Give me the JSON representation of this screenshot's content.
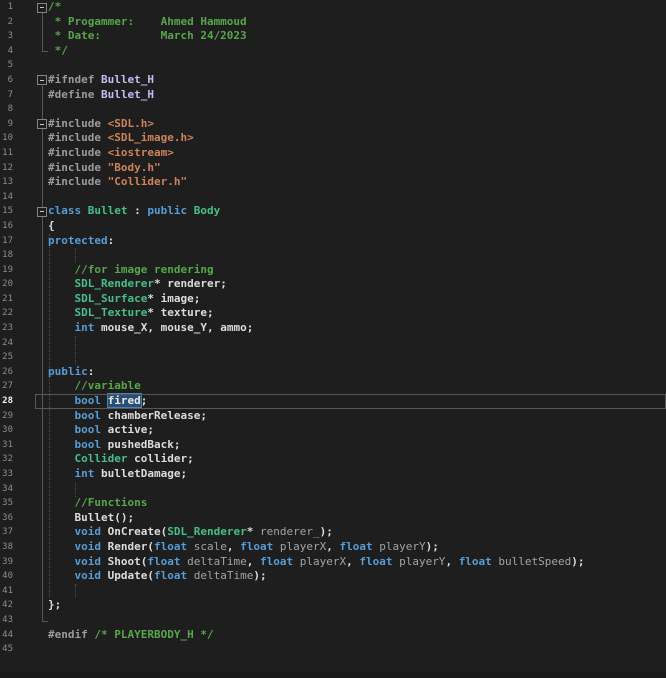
{
  "editor": {
    "kind": "code-editor-dark-theme",
    "current_line": 28,
    "selected_word": "fired",
    "total_lines": 45,
    "colors": {
      "background": "#1e1e1e",
      "plain_text": "#dcdcdc",
      "keyword": "#569cd6",
      "type": "#45c08a",
      "comment": "#57a64a",
      "string": "#ce8259",
      "preprocessor": "#9b9b9b",
      "macro": "#c3bcf5",
      "parameter": "#a3a3a3",
      "line_number": "#8c8c8c",
      "selection_background": "#264f78",
      "current_line_border": "#585858"
    },
    "lines": [
      {
        "n": 1,
        "fold": true,
        "tokens": [
          [
            "c",
            "/*"
          ]
        ]
      },
      {
        "n": 2,
        "tokens": [
          [
            "c",
            " * Progammer:    Ahmed Hammoud"
          ]
        ]
      },
      {
        "n": 3,
        "tokens": [
          [
            "c",
            " * Date:         March 24/2023"
          ]
        ]
      },
      {
        "n": 4,
        "tokens": [
          [
            "c",
            " */"
          ]
        ]
      },
      {
        "n": 5,
        "tokens": []
      },
      {
        "n": 6,
        "fold": true,
        "tokens": [
          [
            "d",
            "#ifndef "
          ],
          [
            "m",
            "Bullet_H"
          ]
        ]
      },
      {
        "n": 7,
        "tokens": [
          [
            "d",
            "#define "
          ],
          [
            "m",
            "Bullet_H"
          ]
        ]
      },
      {
        "n": 8,
        "tokens": []
      },
      {
        "n": 9,
        "fold": true,
        "tokens": [
          [
            "d",
            "#include "
          ],
          [
            "s",
            "<SDL.h>"
          ]
        ]
      },
      {
        "n": 10,
        "tokens": [
          [
            "d",
            "#include "
          ],
          [
            "s",
            "<SDL_image.h>"
          ]
        ]
      },
      {
        "n": 11,
        "tokens": [
          [
            "d",
            "#include "
          ],
          [
            "s",
            "<iostream>"
          ]
        ]
      },
      {
        "n": 12,
        "tokens": [
          [
            "d",
            "#include "
          ],
          [
            "s",
            "\"Body.h\""
          ]
        ]
      },
      {
        "n": 13,
        "tokens": [
          [
            "d",
            "#include "
          ],
          [
            "s",
            "\"Collider.h\""
          ]
        ]
      },
      {
        "n": 14,
        "tokens": []
      },
      {
        "n": 15,
        "fold": true,
        "tokens": [
          [
            "k",
            "class"
          ],
          [
            "p",
            " "
          ],
          [
            "t",
            "Bullet"
          ],
          [
            "p",
            " : "
          ],
          [
            "k",
            "public"
          ],
          [
            "p",
            " "
          ],
          [
            "t",
            "Body"
          ]
        ]
      },
      {
        "n": 16,
        "tokens": [
          [
            "p",
            "{"
          ]
        ]
      },
      {
        "n": 17,
        "tokens": [
          [
            "k",
            "protected"
          ],
          [
            "p",
            ":"
          ]
        ]
      },
      {
        "n": 18,
        "tokens": []
      },
      {
        "n": 19,
        "tokens": [
          [
            "p",
            "    "
          ],
          [
            "c",
            "//for image rendering"
          ]
        ]
      },
      {
        "n": 20,
        "tokens": [
          [
            "p",
            "    "
          ],
          [
            "t",
            "SDL_Renderer"
          ],
          [
            "p",
            "* renderer;"
          ]
        ]
      },
      {
        "n": 21,
        "tokens": [
          [
            "p",
            "    "
          ],
          [
            "t",
            "SDL_Surface"
          ],
          [
            "p",
            "* image;"
          ]
        ]
      },
      {
        "n": 22,
        "tokens": [
          [
            "p",
            "    "
          ],
          [
            "t",
            "SDL_Texture"
          ],
          [
            "p",
            "* texture;"
          ]
        ]
      },
      {
        "n": 23,
        "tokens": [
          [
            "p",
            "    "
          ],
          [
            "k",
            "int"
          ],
          [
            "p",
            " mouse_X, mouse_Y, ammo;"
          ]
        ]
      },
      {
        "n": 24,
        "tokens": []
      },
      {
        "n": 25,
        "tokens": []
      },
      {
        "n": 26,
        "tokens": [
          [
            "k",
            "public"
          ],
          [
            "p",
            ":"
          ]
        ]
      },
      {
        "n": 27,
        "tokens": [
          [
            "p",
            "    "
          ],
          [
            "c",
            "//variable"
          ]
        ]
      },
      {
        "n": 28,
        "tokens": [
          [
            "p",
            "    "
          ],
          [
            "k",
            "bool"
          ],
          [
            "p",
            " "
          ],
          [
            "sel",
            "fired"
          ],
          [
            "p",
            ";"
          ]
        ]
      },
      {
        "n": 29,
        "tokens": [
          [
            "p",
            "    "
          ],
          [
            "k",
            "bool"
          ],
          [
            "p",
            " chamberRelease;"
          ]
        ]
      },
      {
        "n": 30,
        "tokens": [
          [
            "p",
            "    "
          ],
          [
            "k",
            "bool"
          ],
          [
            "p",
            " active;"
          ]
        ]
      },
      {
        "n": 31,
        "tokens": [
          [
            "p",
            "    "
          ],
          [
            "k",
            "bool"
          ],
          [
            "p",
            " pushedBack;"
          ]
        ]
      },
      {
        "n": 32,
        "tokens": [
          [
            "p",
            "    "
          ],
          [
            "t",
            "Collider"
          ],
          [
            "p",
            " collider;"
          ]
        ]
      },
      {
        "n": 33,
        "tokens": [
          [
            "p",
            "    "
          ],
          [
            "k",
            "int"
          ],
          [
            "p",
            " bulletDamage;"
          ]
        ]
      },
      {
        "n": 34,
        "tokens": []
      },
      {
        "n": 35,
        "tokens": [
          [
            "p",
            "    "
          ],
          [
            "c",
            "//Functions"
          ]
        ]
      },
      {
        "n": 36,
        "tokens": [
          [
            "p",
            "    Bullet();"
          ]
        ]
      },
      {
        "n": 37,
        "tokens": [
          [
            "p",
            "    "
          ],
          [
            "k",
            "void"
          ],
          [
            "p",
            " OnCreate("
          ],
          [
            "t",
            "SDL_Renderer"
          ],
          [
            "p",
            "* "
          ],
          [
            "a",
            "renderer_"
          ],
          [
            "p",
            ");"
          ]
        ]
      },
      {
        "n": 38,
        "tokens": [
          [
            "p",
            "    "
          ],
          [
            "k",
            "void"
          ],
          [
            "p",
            " Render("
          ],
          [
            "k",
            "float"
          ],
          [
            "a",
            " scale"
          ],
          [
            "p",
            ", "
          ],
          [
            "k",
            "float"
          ],
          [
            "a",
            " playerX"
          ],
          [
            "p",
            ", "
          ],
          [
            "k",
            "float"
          ],
          [
            "a",
            " playerY"
          ],
          [
            "p",
            ");"
          ]
        ]
      },
      {
        "n": 39,
        "tokens": [
          [
            "p",
            "    "
          ],
          [
            "k",
            "void"
          ],
          [
            "p",
            " Shoot("
          ],
          [
            "k",
            "float"
          ],
          [
            "a",
            " deltaTime"
          ],
          [
            "p",
            ", "
          ],
          [
            "k",
            "float"
          ],
          [
            "a",
            " playerX"
          ],
          [
            "p",
            ", "
          ],
          [
            "k",
            "float"
          ],
          [
            "a",
            " playerY"
          ],
          [
            "p",
            ", "
          ],
          [
            "k",
            "float"
          ],
          [
            "a",
            " bulletSpeed"
          ],
          [
            "p",
            ");"
          ]
        ]
      },
      {
        "n": 40,
        "tokens": [
          [
            "p",
            "    "
          ],
          [
            "k",
            "void"
          ],
          [
            "p",
            " Update("
          ],
          [
            "k",
            "float"
          ],
          [
            "a",
            " deltaTime"
          ],
          [
            "p",
            ");"
          ]
        ]
      },
      {
        "n": 41,
        "tokens": []
      },
      {
        "n": 42,
        "tokens": [
          [
            "p",
            "};"
          ]
        ]
      },
      {
        "n": 43,
        "tokens": []
      },
      {
        "n": 44,
        "tokens": [
          [
            "d",
            "#endif "
          ],
          [
            "c",
            "/* PLAYERBODY_H */"
          ]
        ]
      },
      {
        "n": 45,
        "tokens": []
      }
    ]
  }
}
